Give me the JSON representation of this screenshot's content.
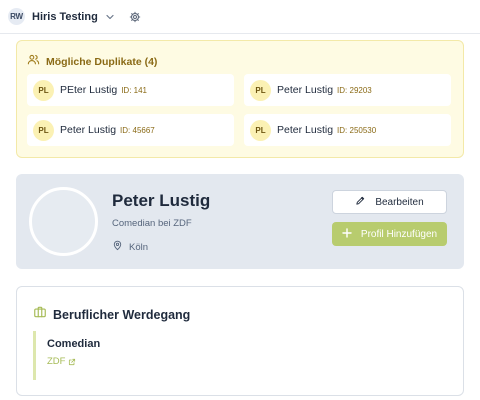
{
  "workspace": {
    "initials": "RW",
    "name": "Hiris Testing"
  },
  "duplicates": {
    "title": "Mögliche Duplikate (4)",
    "items": [
      {
        "initials": "PL",
        "name": "PEter Lustig",
        "id": "ID: 141"
      },
      {
        "initials": "PL",
        "name": "Peter Lustig",
        "id": "ID: 29203"
      },
      {
        "initials": "PL",
        "name": "Peter Lustig",
        "id": "ID: 45667"
      },
      {
        "initials": "PL",
        "name": "Peter Lustig",
        "id": "ID: 250530"
      }
    ]
  },
  "profile": {
    "name": "Peter Lustig",
    "role": "Comedian bei ZDF",
    "location": "Köln",
    "edit_label": "Bearbeiten",
    "add_label": "Profil Hinzufügen"
  },
  "career": {
    "title": "Beruflicher Werdegang",
    "entries": [
      {
        "role": "Comedian",
        "company": "ZDF"
      }
    ]
  },
  "icons": {
    "workspace_menu": "chevron-down-icon",
    "settings": "gear-icon",
    "duplicates": "users-icon",
    "edit": "pencil-icon",
    "add": "plus-icon",
    "location": "map-pin-icon",
    "career": "briefcase-icon",
    "external": "external-link-icon"
  },
  "colors": {
    "accent_green": "#b8cc6e",
    "duplicate_bg": "#fefbe3",
    "duplicate_text": "#8a6a16",
    "profile_bg": "#e3e8ef"
  }
}
